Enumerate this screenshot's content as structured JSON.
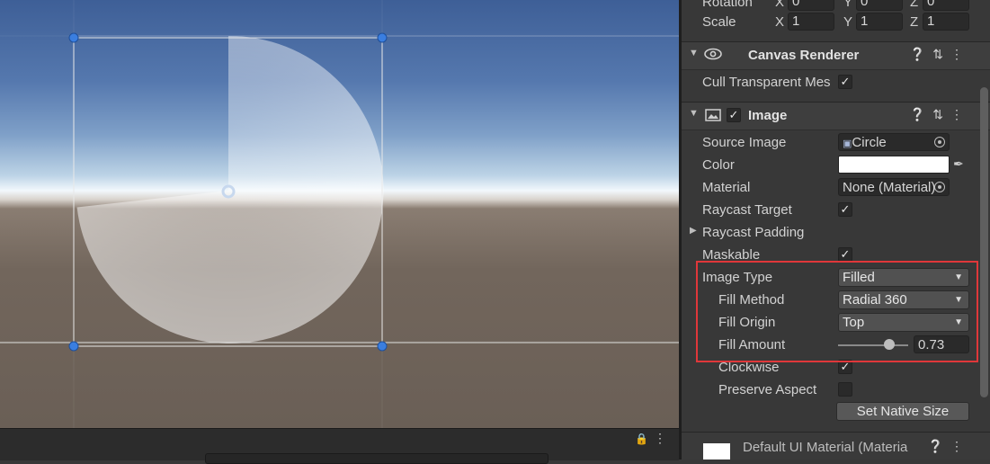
{
  "scene": {
    "footer_lock_icon": "lock-icon",
    "footer_menu_icon": "kebab-icon"
  },
  "inspector": {
    "transform": {
      "rotation_label": "Rotation",
      "rotation": {
        "x": "0",
        "y": "0",
        "z": "0"
      },
      "scale_label": "Scale",
      "scale": {
        "x": "1",
        "y": "1",
        "z": "1"
      }
    },
    "canvas_renderer": {
      "title": "Canvas Renderer",
      "cull_label": "Cull Transparent Mes",
      "cull_checked": true
    },
    "image": {
      "title": "Image",
      "enabled": true,
      "source_image_label": "Source Image",
      "source_image_value": "Circle",
      "color_label": "Color",
      "color_value": "#ffffff",
      "material_label": "Material",
      "material_value": "None (Material)",
      "raycast_target_label": "Raycast Target",
      "raycast_padding_label": "Raycast Padding",
      "maskable_label": "Maskable",
      "image_type_label": "Image Type",
      "image_type_value": "Filled",
      "fill_method_label": "Fill Method",
      "fill_method_value": "Radial 360",
      "fill_origin_label": "Fill Origin",
      "fill_origin_value": "Top",
      "fill_amount_label": "Fill Amount",
      "fill_amount_value": "0.73",
      "fill_amount": 0.73,
      "clockwise_label": "Clockwise",
      "preserve_aspect_label": "Preserve Aspect",
      "set_native_size_label": "Set Native Size"
    },
    "material_footer": {
      "title": "Default UI Material (Materia"
    }
  },
  "colors": {
    "highlight": "#e0373a",
    "handle": "#3a7ee0"
  }
}
